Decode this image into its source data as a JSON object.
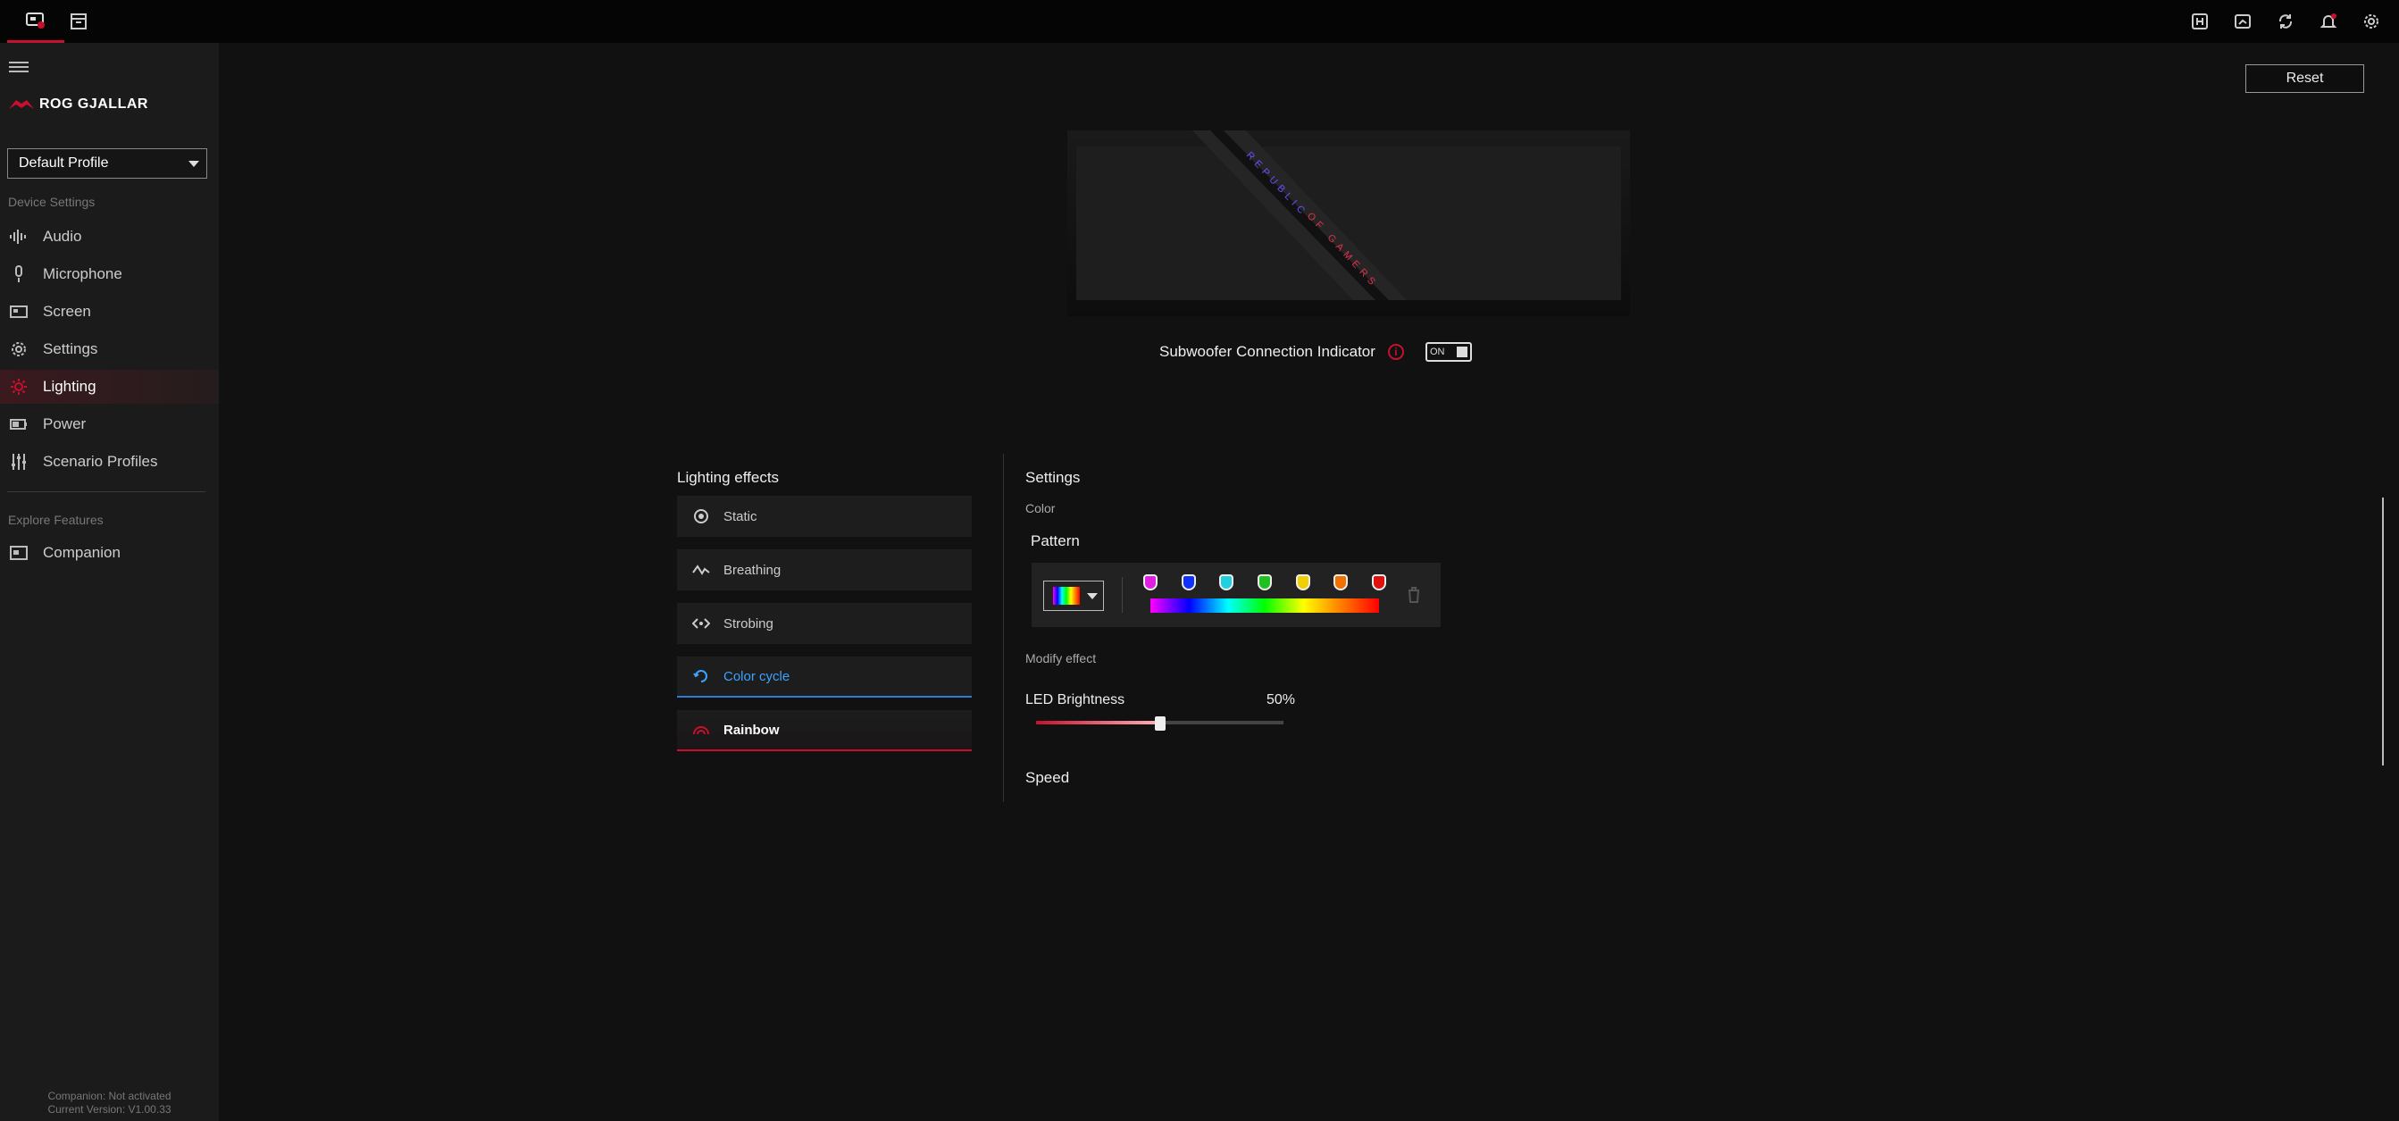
{
  "topbar": {
    "left_icons": [
      "device-icon",
      "store-icon"
    ],
    "right_icons": [
      "hotkey-icon",
      "screenshot-icon",
      "sync-icon",
      "notification-icon",
      "settings-icon"
    ]
  },
  "sidebar": {
    "device_name": "ROG GJALLAR",
    "profile": "Default Profile",
    "device_settings_label": "Device Settings",
    "items": [
      {
        "label": "Audio",
        "icon": "audio-wave-icon"
      },
      {
        "label": "Microphone",
        "icon": "microphone-icon"
      },
      {
        "label": "Screen",
        "icon": "screen-icon"
      },
      {
        "label": "Settings",
        "icon": "gear-icon"
      },
      {
        "label": "Lighting",
        "icon": "lighting-icon"
      },
      {
        "label": "Power",
        "icon": "battery-icon"
      },
      {
        "label": "Scenario Profiles",
        "icon": "sliders-icon"
      }
    ],
    "explore_label": "Explore Features",
    "companion_label": "Companion",
    "footer_status": "Companion: Not activated",
    "footer_version": "Current Version: V1.00.33"
  },
  "main": {
    "reset_label": "Reset",
    "indicator_label": "Subwoofer Connection Indicator",
    "indicator_toggle": "ON",
    "effects_title": "Lighting effects",
    "effects": [
      {
        "label": "Static",
        "icon": "static-icon"
      },
      {
        "label": "Breathing",
        "icon": "breathing-icon"
      },
      {
        "label": "Strobing",
        "icon": "strobing-icon"
      },
      {
        "label": "Color cycle",
        "icon": "color-cycle-icon"
      },
      {
        "label": "Rainbow",
        "icon": "rainbow-icon"
      }
    ],
    "settings_title": "Settings",
    "color_label": "Color",
    "pattern_label": "Pattern",
    "pattern_stops": [
      "#e020e0",
      "#1030ff",
      "#20d0e0",
      "#20c020",
      "#f0d000",
      "#f07000",
      "#e01010"
    ],
    "modify_label": "Modify effect",
    "brightness_label": "LED Brightness",
    "brightness_value": "50%",
    "brightness_level": 0.5,
    "speed_label": "Speed"
  },
  "colors": {
    "accent_red": "#c8102e",
    "accent_blue": "#3aa3ff"
  }
}
